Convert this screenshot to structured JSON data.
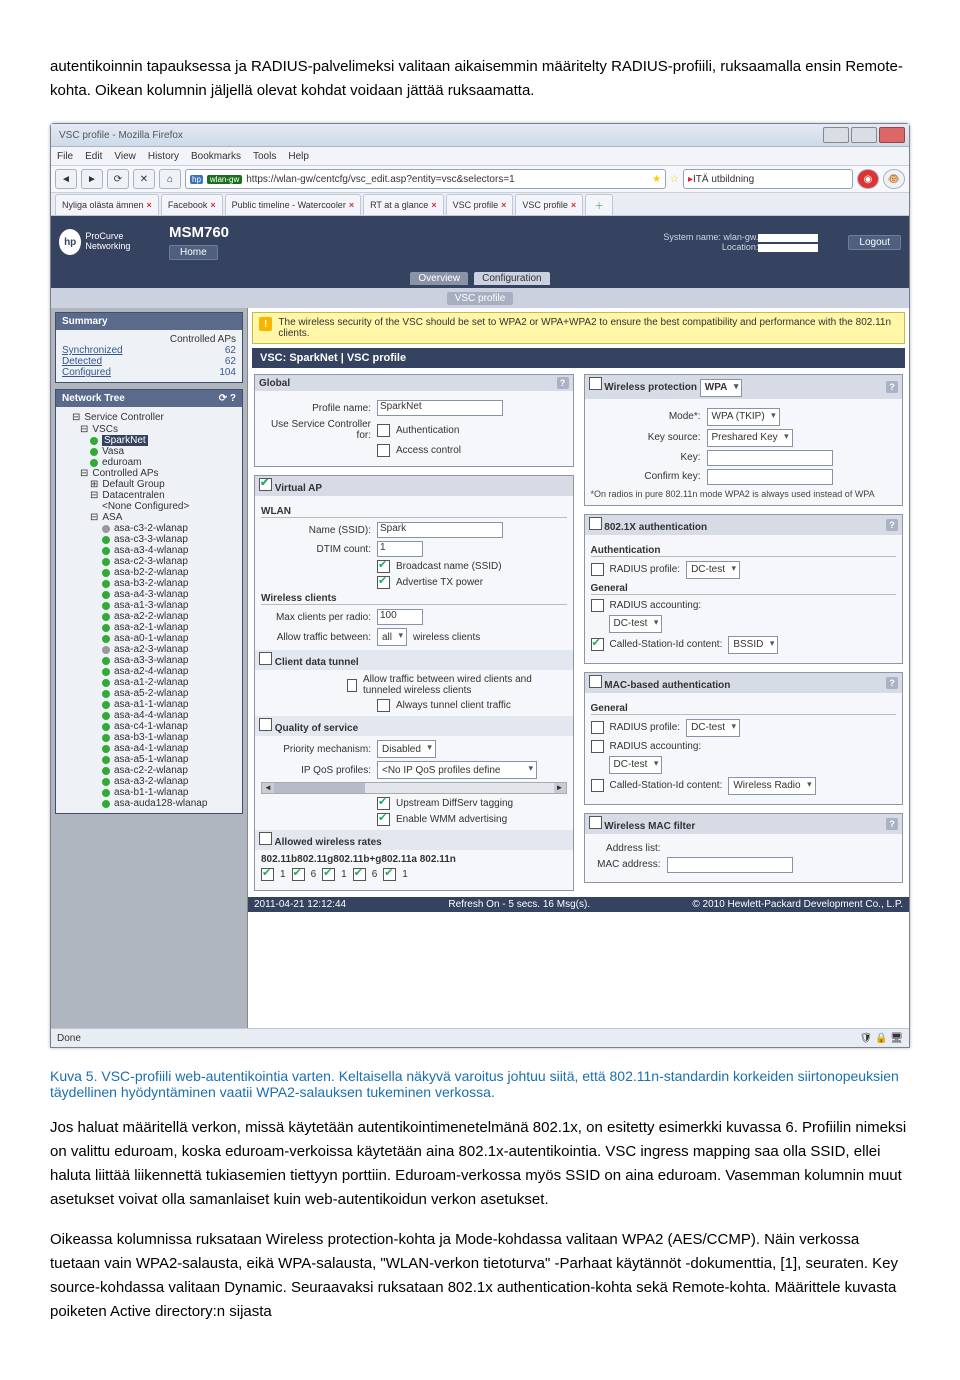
{
  "paragraphs": {
    "p1": "autentikoinnin tapauksessa ja RADIUS-palvelimeksi valitaan aikaisemmin määritelty RADIUS-profiili, ruksaamalla ensin Remote-kohta. Oikean kolumnin jäljellä olevat kohdat voidaan jättää ruksaamatta.",
    "caption": "Kuva 5. VSC-profiili web-autentikointia varten. Keltaisella näkyvä varoitus johtuu siitä, että 802.11n-standardin korkeiden siirtonopeuksien täydellinen hyödyntäminen vaatii WPA2-salauksen tukeminen verkossa.",
    "p2": "Jos haluat määritellä verkon, missä käytetään autentikointimenetelmänä 802.1x, on esitetty esimerkki kuvassa 6. Profiilin nimeksi on valittu eduroam, koska eduroam-verkoissa käytetään aina 802.1x-autentikointia. VSC ingress mapping saa olla SSID, ellei haluta liittää liikennettä tukiasemien tiettyyn porttiin. Eduroam-verkossa myös SSID on aina eduroam. Vasemman kolumnin muut asetukset voivat olla samanlaiset kuin web-autentikoidun verkon asetukset.",
    "p3": "Oikeassa kolumnissa ruksataan Wireless protection-kohta ja Mode-kohdassa valitaan WPA2 (AES/CCMP). Näin verkossa tuetaan vain WPA2-salausta, eikä WPA-salausta, \"WLAN-verkon tietoturva\" -Parhaat käytännöt -dokumenttia, [1], seuraten. Key source-kohdassa valitaan Dynamic. Seuraavaksi ruksataan 802.1x authentication-kohta sekä Remote-kohta. Määrittele kuvasta poiketen Active directory:n sijasta"
  },
  "browser": {
    "title": "VSC profile - Mozilla Firefox",
    "menu": [
      "File",
      "Edit",
      "View",
      "History",
      "Bookmarks",
      "Tools",
      "Help"
    ],
    "url": "https://wlan-gw/centcfg/vsc_edit.asp?entity=vsc&selectors=1",
    "search": "ITÄ utbildning",
    "tabs": [
      "Nyliga olästa ämnen",
      "Facebook",
      "Public timeline - Watercooler",
      "RT at a glance",
      "VSC profile",
      "VSC profile"
    ],
    "status": "Done"
  },
  "app": {
    "logoText": "ProCurve\nNetworking",
    "model": "MSM760",
    "home": "Home",
    "sysname_label": "System name: wlan-gw.",
    "loc_label": "Location:",
    "logout": "Logout",
    "tabs1": [
      "Overview",
      "Configuration"
    ],
    "tab2": "VSC profile",
    "warn": "The wireless security of the VSC should be set to WPA2 or WPA+WPA2 to ensure the best compatibility and performance with the 802.11n clients.",
    "crumb": "VSC: SparkNet  |  VSC profile",
    "footer_ts": "2011-04-21 12:12:44",
    "footer_refresh": "Refresh On - 5 secs.     16 Msg(s).",
    "footer_right": "© 2010 Hewlett-Packard Development Co., L.P."
  },
  "sidebar": {
    "summary_head": "Summary",
    "summary_link": "Controlled APs",
    "summary": [
      {
        "label": "Synchronized",
        "val": "62"
      },
      {
        "label": "Detected",
        "val": "62"
      },
      {
        "label": "Configured",
        "val": "104"
      }
    ],
    "tree_head": "Network Tree",
    "sc": "Service Controller",
    "vscs": "VSCs",
    "vsc_items": [
      "SparkNet",
      "Vasa",
      "eduroam"
    ],
    "cap": "Controlled APs",
    "defgroup": "Default Group",
    "dc": "Datacentralen",
    "none": "<None Configured>",
    "asa_head": "ASA",
    "asa": [
      "asa-c3-2-wlanap",
      "asa-c3-3-wlanap",
      "asa-a3-4-wlanap",
      "asa-c2-3-wlanap",
      "asa-b2-2-wlanap",
      "asa-b3-2-wlanap",
      "asa-a4-3-wlanap",
      "asa-a1-3-wlanap",
      "asa-a2-2-wlanap",
      "asa-a2-1-wlanap",
      "asa-a0-1-wlanap",
      "asa-a2-3-wlanap",
      "asa-a3-3-wlanap",
      "asa-a2-4-wlanap",
      "asa-a1-2-wlanap",
      "asa-a5-2-wlanap",
      "asa-a1-1-wlanap",
      "asa-a4-4-wlanap",
      "asa-c4-1-wlanap",
      "asa-b3-1-wlanap",
      "asa-a4-1-wlanap",
      "asa-a5-1-wlanap",
      "asa-c2-2-wlanap",
      "asa-a3-2-wlanap",
      "asa-b1-1-wlanap",
      "asa-auda128-wlanap"
    ]
  },
  "form": {
    "global": {
      "head": "Global",
      "pn_label": "Profile name:",
      "pn_val": "SparkNet",
      "usc_label": "Use Service Controller for:",
      "auth": "Authentication",
      "access": "Access control"
    },
    "vap": {
      "head": "Virtual AP",
      "wlan_head": "WLAN",
      "ssid_label": "Name (SSID):",
      "ssid_val": "Spark",
      "dtim_label": "DTIM count:",
      "dtim_val": "1",
      "bcast": "Broadcast name (SSID)",
      "advtx": "Advertise TX power",
      "wc_head": "Wireless clients",
      "max_label": "Max clients per radio:",
      "max_val": "100",
      "allow_label": "Allow traffic between:",
      "allow_sel": "all",
      "allow_suffix": "wireless clients",
      "cdt_head": "Client data tunnel",
      "cdt1": "Allow traffic between wired clients and tunneled wireless clients",
      "cdt2": "Always tunnel client traffic",
      "qos_head": "Quality of service",
      "prio_label": "Priority mechanism:",
      "prio_sel": "Disabled",
      "ipq_label": "IP QoS profiles:",
      "ipq_sel": "<No IP QoS profiles define",
      "ds": "Upstream DiffServ tagging",
      "wmm": "Enable WMM advertising",
      "rates_head": "Allowed wireless rates",
      "rates_line": "802.11b802.11g802.11b+g802.11a    802.11n"
    },
    "wp": {
      "head": "Wireless protection",
      "sel": "WPA",
      "mode_label": "Mode*:",
      "mode_sel": "WPA (TKIP)",
      "ks_label": "Key source:",
      "ks_sel": "Preshared Key",
      "key_label": "Key:",
      "ck_label": "Confirm key:",
      "note": "*On radios in pure 802.11n mode WPA2 is always used instead of WPA"
    },
    "dot1x": {
      "head": "802.1X authentication",
      "auth_head": "Authentication",
      "rp_label": "RADIUS profile:",
      "rp_sel": "DC-test",
      "gen_head": "General",
      "ra_label": "RADIUS accounting:",
      "ra_sel": "DC-test",
      "csi_label": "Called-Station-Id content:",
      "csi_sel": "BSSID"
    },
    "mac": {
      "head": "MAC-based authentication",
      "gen_head": "General",
      "rp_label": "RADIUS profile:",
      "rp_sel": "DC-test",
      "ra_label": "RADIUS accounting:",
      "ra_sel": "DC-test",
      "csi_label": "Called-Station-Id content:",
      "csi_sel": "Wireless Radio"
    },
    "macf": {
      "head": "Wireless MAC filter",
      "addr_label": "Address list:",
      "mac_label": "MAC address:"
    }
  }
}
